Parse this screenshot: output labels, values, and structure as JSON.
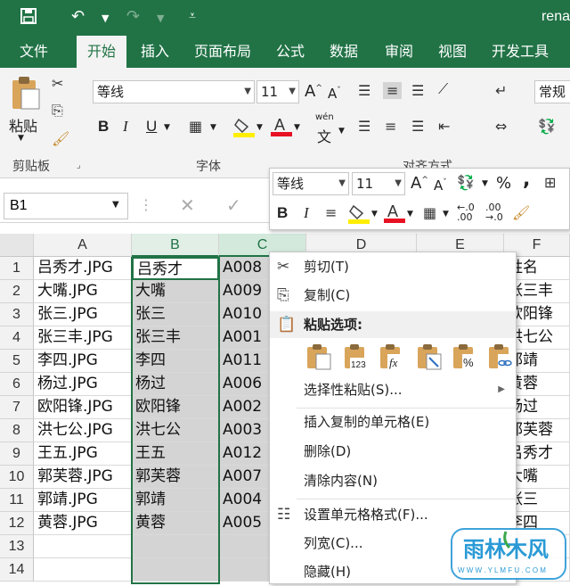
{
  "title": "rena",
  "tabs": [
    "文件",
    "开始",
    "插入",
    "页面布局",
    "公式",
    "数据",
    "审阅",
    "视图",
    "开发工具"
  ],
  "ribbon": {
    "paste_label": "粘贴",
    "font_name": "等线",
    "font_size": "11",
    "bold": "B",
    "italic": "I",
    "underline": "U",
    "wen_label": "wén",
    "wen_char": "文",
    "number_format": "常规",
    "groups": {
      "clipboard": "剪贴板",
      "font": "字体",
      "alignment": "对齐方式"
    }
  },
  "mini_toolbar": {
    "font_name": "等线",
    "font_size": "11",
    "bold": "B",
    "italic": "I",
    "percent": "%",
    "comma": ","
  },
  "name_box": "B1",
  "columns": [
    "A",
    "B",
    "C",
    "D",
    "E",
    "F"
  ],
  "rows": [
    {
      "n": "1",
      "a": "吕秀才.JPG",
      "b": "吕秀才",
      "c": "A008",
      "f": "姓名"
    },
    {
      "n": "2",
      "a": "大嘴.JPG",
      "b": "大嘴",
      "c": "A009",
      "f": "张三丰"
    },
    {
      "n": "3",
      "a": "张三.JPG",
      "b": "张三",
      "c": "A010",
      "f": "欧阳锋"
    },
    {
      "n": "4",
      "a": "张三丰.JPG",
      "b": "张三丰",
      "c": "A001",
      "f": "洪七公"
    },
    {
      "n": "5",
      "a": "李四.JPG",
      "b": "李四",
      "c": "A011",
      "f": "郭靖"
    },
    {
      "n": "6",
      "a": "杨过.JPG",
      "b": "杨过",
      "c": "A006",
      "f": "黄蓉"
    },
    {
      "n": "7",
      "a": "欧阳锋.JPG",
      "b": "欧阳锋",
      "c": "A002",
      "f": "杨过"
    },
    {
      "n": "8",
      "a": "洪七公.JPG",
      "b": "洪七公",
      "c": "A003",
      "f": "郭芙蓉"
    },
    {
      "n": "9",
      "a": "王五.JPG",
      "b": "王五",
      "c": "A012",
      "f": "吕秀才"
    },
    {
      "n": "10",
      "a": "郭芙蓉.JPG",
      "b": "郭芙蓉",
      "c": "A007",
      "f": "大嘴"
    },
    {
      "n": "11",
      "a": "郭靖.JPG",
      "b": "郭靖",
      "c": "A004",
      "f": "张三"
    },
    {
      "n": "12",
      "a": "黄蓉.JPG",
      "b": "黄蓉",
      "c": "A005",
      "f": "李四"
    },
    {
      "n": "13",
      "a": "",
      "b": "",
      "c": "",
      "f": ""
    },
    {
      "n": "14",
      "a": "",
      "b": "",
      "c": "",
      "f": ""
    }
  ],
  "context_menu": {
    "cut": "剪切(T)",
    "copy": "复制(C)",
    "paste_options": "粘贴选项:",
    "paste_special": "选择性粘贴(S)...",
    "insert_copied": "插入复制的单元格(E)",
    "delete": "删除(D)",
    "clear": "清除内容(N)",
    "format_cells": "设置单元格格式(F)...",
    "col_width": "列宽(C)...",
    "hide": "隐藏(H)"
  },
  "watermark": {
    "text": "雨林木风",
    "url": "W W W . Y L M F U . C O M"
  },
  "colors": {
    "excel_green": "#217346",
    "selected_grey": "#d4d4d4",
    "font_red": "#e81123",
    "highlight_yellow": "#ffee00"
  }
}
